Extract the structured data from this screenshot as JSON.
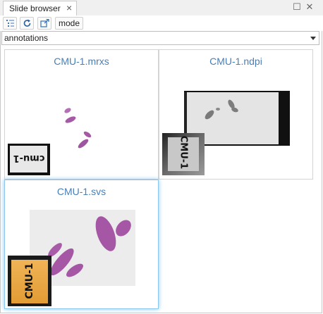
{
  "panel": {
    "tab_title": "Slide browser",
    "close_glyph": "×",
    "maximize_glyph": "☐",
    "window_close_glyph": "✕"
  },
  "toolbar": {
    "buttons": [
      {
        "icon": "list-settings-icon"
      },
      {
        "icon": "refresh-icon"
      },
      {
        "icon": "export-icon"
      }
    ],
    "mode_label": "mode"
  },
  "filter_select": {
    "value": "annotations"
  },
  "slides": [
    {
      "name": "CMU-1.mrxs",
      "label_text": "cmu-1",
      "selected": false
    },
    {
      "name": "CMU-1.ndpi",
      "label_text": "CMU-1",
      "selected": false
    },
    {
      "name": "CMU-1.svs",
      "label_text": "CMU-1",
      "selected": true
    }
  ],
  "colors": {
    "title_link": "#4a7fb5",
    "selection_glow": "#86c4ef",
    "tissue": "#a65aa5",
    "label_orange": "#e6a23c"
  }
}
